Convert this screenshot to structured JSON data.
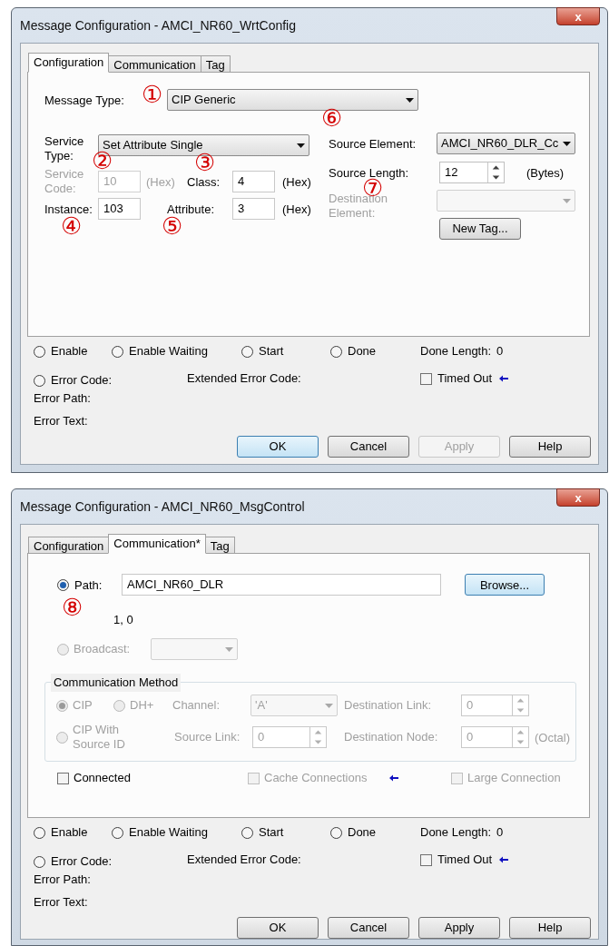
{
  "dialogs": [
    {
      "title": "Message Configuration - AMCI_NR60_WrtConfig",
      "close": "x",
      "tabs": [
        {
          "label": "Configuration",
          "selected": true
        },
        {
          "label": "Communication",
          "selected": false
        },
        {
          "label": "Tag",
          "selected": false
        }
      ],
      "panel": {
        "kind": "configuration",
        "message_type": {
          "label": "Message Type:",
          "value": "CIP Generic",
          "marker": "①"
        },
        "service_type": {
          "label": "Service Type:",
          "value": "Set Attribute Single",
          "marker": "②"
        },
        "service_code": {
          "label": "Service Code:",
          "value": "10",
          "unit": "(Hex)",
          "disabled": true
        },
        "class": {
          "label": "Class:",
          "value": "4",
          "unit": "(Hex)",
          "marker": "③"
        },
        "instance": {
          "label": "Instance:",
          "value": "103",
          "marker": "④"
        },
        "attribute": {
          "label": "Attribute:",
          "value": "3",
          "unit": "(Hex)",
          "marker": "⑤"
        },
        "source_element": {
          "label": "Source Element:",
          "value": "AMCI_NR60_DLR_Cc",
          "marker": "⑥"
        },
        "source_length": {
          "label": "Source Length:",
          "value": "12",
          "unit": "(Bytes)",
          "marker": "⑦"
        },
        "destination_element": {
          "label": "Destination Element:",
          "disabled": true
        },
        "new_tag_button": "New Tag..."
      },
      "status": {
        "radios": [
          {
            "label": "Enable",
            "selected": false
          },
          {
            "label": "Enable Waiting",
            "selected": false
          },
          {
            "label": "Start",
            "selected": false
          },
          {
            "label": "Done",
            "selected": false
          }
        ],
        "done_length": {
          "label": "Done Length:",
          "value": "0"
        },
        "error_code": {
          "label": "Error Code:",
          "selected": false
        },
        "extended_error_code": "Extended Error Code:",
        "timed_out": {
          "label": "Timed Out",
          "checked": false,
          "pointer": true
        },
        "error_path": "Error Path:",
        "error_text": "Error Text:"
      },
      "buttons": [
        {
          "label": "OK",
          "default": true,
          "disabled": false
        },
        {
          "label": "Cancel",
          "default": false,
          "disabled": false
        },
        {
          "label": "Apply",
          "default": false,
          "disabled": true
        },
        {
          "label": "Help",
          "default": false,
          "disabled": false
        }
      ]
    },
    {
      "title": "Message Configuration - AMCI_NR60_MsgControl",
      "close": "x",
      "tabs": [
        {
          "label": "Configuration",
          "selected": false
        },
        {
          "label": "Communication*",
          "selected": true
        },
        {
          "label": "Tag",
          "selected": false
        }
      ],
      "panel": {
        "kind": "communication",
        "path": {
          "label": "Path:",
          "value": "AMCI_NR60_DLR",
          "selected": true,
          "marker": "⑧"
        },
        "path_detail": "1, 0",
        "browse_button": {
          "label": "Browse...",
          "focused": true
        },
        "broadcast": {
          "label": "Broadcast:",
          "selected": false,
          "disabled": true
        },
        "method": {
          "title": "Communication Method",
          "disabled": true,
          "options": [
            {
              "label": "CIP",
              "selected": true
            },
            {
              "label": "DH+",
              "selected": false
            },
            {
              "label": "CIP With Source ID",
              "selected": false
            }
          ],
          "channel": {
            "label": "Channel:",
            "value": "'A'"
          },
          "source_link": {
            "label": "Source Link:",
            "value": "0"
          },
          "destination_link": {
            "label": "Destination Link:",
            "value": "0"
          },
          "destination_node": {
            "label": "Destination Node:",
            "value": "0",
            "unit": "(Octal)"
          }
        },
        "options": [
          {
            "label": "Connected",
            "checked": false,
            "disabled": false,
            "pointer": false
          },
          {
            "label": "Cache Connections",
            "checked": false,
            "disabled": true,
            "pointer": true
          },
          {
            "label": "Large Connection",
            "checked": false,
            "disabled": true,
            "pointer": false
          }
        ]
      },
      "status": {
        "radios": [
          {
            "label": "Enable",
            "selected": false
          },
          {
            "label": "Enable Waiting",
            "selected": false
          },
          {
            "label": "Start",
            "selected": false
          },
          {
            "label": "Done",
            "selected": false
          }
        ],
        "done_length": {
          "label": "Done Length:",
          "value": "0"
        },
        "error_code": {
          "label": "Error Code:",
          "selected": false
        },
        "extended_error_code": "Extended Error Code:",
        "timed_out": {
          "label": "Timed Out",
          "checked": false,
          "pointer": true
        },
        "error_path": "Error Path:",
        "error_text": "Error Text:"
      },
      "buttons": [
        {
          "label": "OK",
          "default": false,
          "disabled": false
        },
        {
          "label": "Cancel",
          "default": false,
          "disabled": false
        },
        {
          "label": "Apply",
          "default": false,
          "disabled": false
        },
        {
          "label": "Help",
          "default": false,
          "disabled": false
        }
      ]
    }
  ]
}
